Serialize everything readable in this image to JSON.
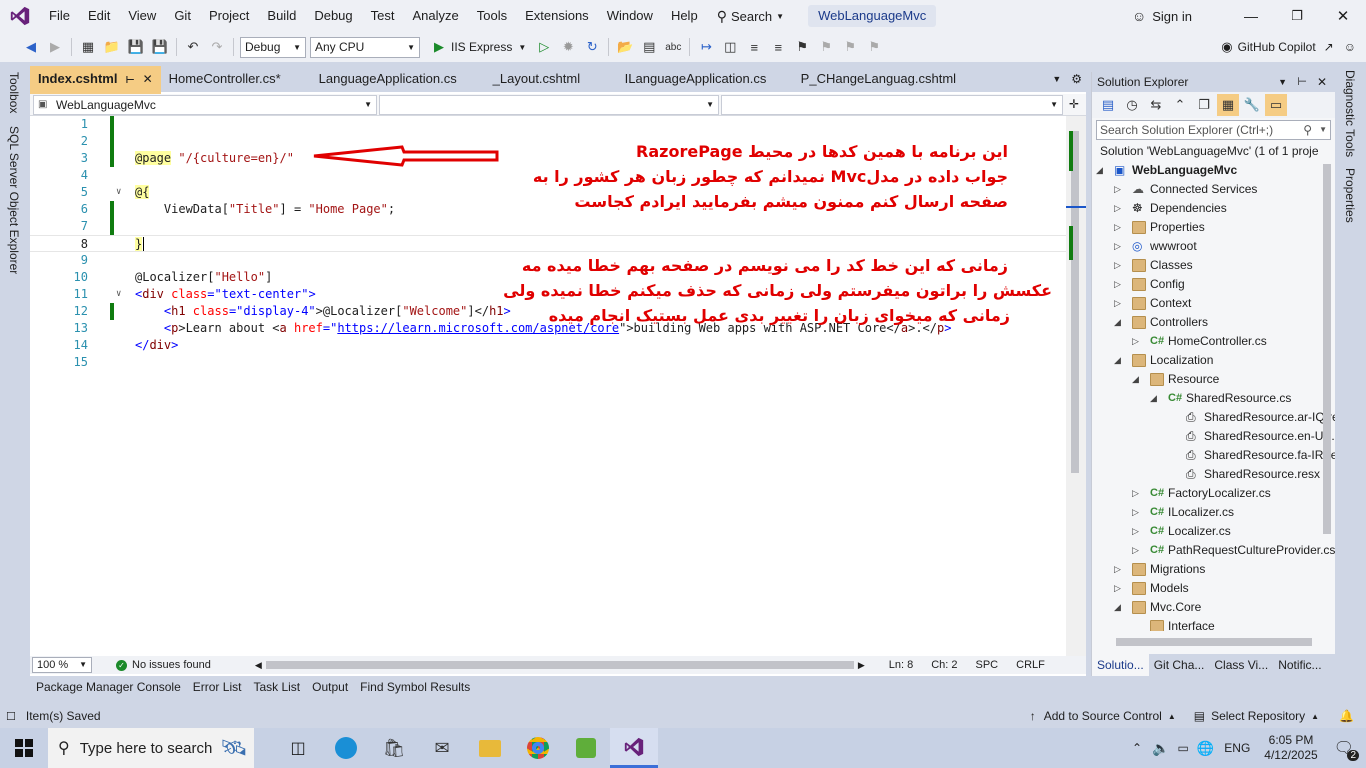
{
  "menu": [
    "File",
    "Edit",
    "View",
    "Git",
    "Project",
    "Build",
    "Debug",
    "Test",
    "Analyze",
    "Tools",
    "Extensions",
    "Window",
    "Help"
  ],
  "search_label": "Search",
  "solution_name": "WebLanguageMvc",
  "sign_in": "Sign in",
  "toolbar": {
    "config": "Debug",
    "platform": "Any CPU",
    "run_label": "IIS Express",
    "copilot": "GitHub Copilot"
  },
  "left_tabs": [
    "Toolbox",
    "SQL Server Object Explorer"
  ],
  "right_tabs": [
    "Diagnostic Tools",
    "Properties"
  ],
  "tabs": [
    {
      "label": "Index.cshtml",
      "active": true
    },
    {
      "label": "HomeController.cs*",
      "active": false
    },
    {
      "label": "LanguageApplication.cs",
      "active": false
    },
    {
      "label": "_Layout.cshtml",
      "active": false
    },
    {
      "label": "ILanguageApplication.cs",
      "active": false
    },
    {
      "label": "P_CHangeLanguag.cshtml",
      "active": false
    }
  ],
  "nav_project": "WebLanguageMvc",
  "code": {
    "l3_kw": "@page",
    "l3_str": " \"/{culture=en}/\"",
    "l5": "@{",
    "l6_a": "    ViewData[",
    "l6_s1": "\"Title\"",
    "l6_b": "] = ",
    "l6_s2": "\"Home Page\"",
    "l6_c": ";",
    "l8": "}",
    "l10_a": "@Localizer[",
    "l10_s": "\"Hello\"",
    "l10_b": "]",
    "l11_a": "<",
    "l11_tag": "div",
    "l11_att": " class",
    "l11_eq": "=",
    "l11_val": "\"text-center\"",
    "l11_b": ">",
    "l12_a": "    <",
    "l12_tag": "h1",
    "l12_att": " class",
    "l12_eq": "=",
    "l12_val": "\"display-4\"",
    "l12_b": ">@Localizer[",
    "l12_s": "\"Welcome\"",
    "l12_c": "]</",
    "l12_tag2": "h1",
    "l12_d": ">",
    "l13_a": "    <",
    "l13_tag": "p",
    "l13_b": ">Learn about <",
    "l13_tag2": "a",
    "l13_att": " href",
    "l13_eq": "=\"",
    "l13_link": "https://learn.microsoft.com/aspnet/core",
    "l13_c": "\">building Web apps with ASP.NET Core</",
    "l13_tag3": "a",
    "l13_d": ">.</",
    "l13_tag4": "p",
    "l13_e": ">",
    "l14_a": "</",
    "l14_tag": "div",
    "l14_b": ">"
  },
  "line_numbers": [
    "1",
    "2",
    "3",
    "4",
    "5",
    "6",
    "7",
    "8",
    "9",
    "10",
    "11",
    "12",
    "13",
    "14",
    "15"
  ],
  "annotations": {
    "n1": "این برنامه با همین کدها در محیط  RazorePage",
    "n2": "جواب داده در مدلMvc نمیدانم که چطور زبان هر کشور را به",
    "n3": "صفحه ارسال کنم ممنون میشم بفرمایید ایرادم کجاست",
    "n4": "زمانی که این خط کد را می نویسم در صفحه بهم خطا میده مه",
    "n5": "عکسش را براتون میفرستم ولی زمانی که حذف میکنم خطا نمیده ولی",
    "n6": "زمانی که میخوای زبان را تغییر بدی عمل بستیک انجام میده"
  },
  "editor_status": {
    "zoom": "100 %",
    "issues": "No issues found",
    "ln": "Ln: 8",
    "ch": "Ch: 2",
    "spc": "SPC",
    "crlf": "CRLF"
  },
  "solution_explorer": {
    "title": "Solution Explorer",
    "search_placeholder": "Search Solution Explorer (Ctrl+;)",
    "solution_line": "Solution 'WebLanguageMvc' (1 of 1 proje",
    "items": [
      {
        "label": "WebLanguageMvc",
        "level": 0,
        "caret": "open",
        "icon": "project"
      },
      {
        "label": "Connected Services",
        "level": 1,
        "caret": "closed",
        "icon": "connected"
      },
      {
        "label": "Dependencies",
        "level": 1,
        "caret": "closed",
        "icon": "deps"
      },
      {
        "label": "Properties",
        "level": 1,
        "caret": "closed",
        "icon": "wrench-folder"
      },
      {
        "label": "wwwroot",
        "level": 1,
        "caret": "closed",
        "icon": "globe"
      },
      {
        "label": "Classes",
        "level": 1,
        "caret": "closed",
        "icon": "folder"
      },
      {
        "label": "Config",
        "level": 1,
        "caret": "closed",
        "icon": "folder"
      },
      {
        "label": "Context",
        "level": 1,
        "caret": "closed",
        "icon": "folder"
      },
      {
        "label": "Controllers",
        "level": 1,
        "caret": "open",
        "icon": "folder"
      },
      {
        "label": "HomeController.cs",
        "level": 2,
        "caret": "closed",
        "icon": "cs"
      },
      {
        "label": "Localization",
        "level": 1,
        "caret": "open",
        "icon": "folder"
      },
      {
        "label": "Resource",
        "level": 2,
        "caret": "open",
        "icon": "folder"
      },
      {
        "label": "SharedResource.cs",
        "level": 3,
        "caret": "open",
        "icon": "cs"
      },
      {
        "label": "SharedResource.ar-IQ.re",
        "level": 4,
        "caret": "none",
        "icon": "file"
      },
      {
        "label": "SharedResource.en-US.r",
        "level": 4,
        "caret": "none",
        "icon": "file"
      },
      {
        "label": "SharedResource.fa-IR.re:",
        "level": 4,
        "caret": "none",
        "icon": "file"
      },
      {
        "label": "SharedResource.resx",
        "level": 4,
        "caret": "none",
        "icon": "file"
      },
      {
        "label": "FactoryLocalizer.cs",
        "level": 2,
        "caret": "closed",
        "icon": "cs"
      },
      {
        "label": "ILocalizer.cs",
        "level": 2,
        "caret": "closed",
        "icon": "cs"
      },
      {
        "label": "Localizer.cs",
        "level": 2,
        "caret": "closed",
        "icon": "cs"
      },
      {
        "label": "PathRequestCultureProvider.cs",
        "level": 2,
        "caret": "closed",
        "icon": "cs"
      },
      {
        "label": "Migrations",
        "level": 1,
        "caret": "closed",
        "icon": "folder"
      },
      {
        "label": "Models",
        "level": 1,
        "caret": "closed",
        "icon": "folder"
      },
      {
        "label": "Mvc.Core",
        "level": 1,
        "caret": "open",
        "icon": "folder"
      },
      {
        "label": "Interface",
        "level": 2,
        "caret": "none",
        "icon": "folder"
      }
    ],
    "bottom_tabs": [
      "Solutio...",
      "Git Cha...",
      "Class Vi...",
      "Notific..."
    ]
  },
  "bottom_tabs": [
    "Package Manager Console",
    "Error List",
    "Task List",
    "Output",
    "Find Symbol Results"
  ],
  "status": {
    "saved": "Item(s) Saved",
    "source_control": "Add to Source Control",
    "repo": "Select Repository"
  },
  "taskbar": {
    "search": "Type here to search",
    "lang": "ENG",
    "time": "6:05 PM",
    "date": "4/12/2025",
    "notif": "2"
  },
  "colors": {
    "accent": "#f5cc84",
    "vs_purple": "#68217a",
    "note_red": "#e00000"
  }
}
